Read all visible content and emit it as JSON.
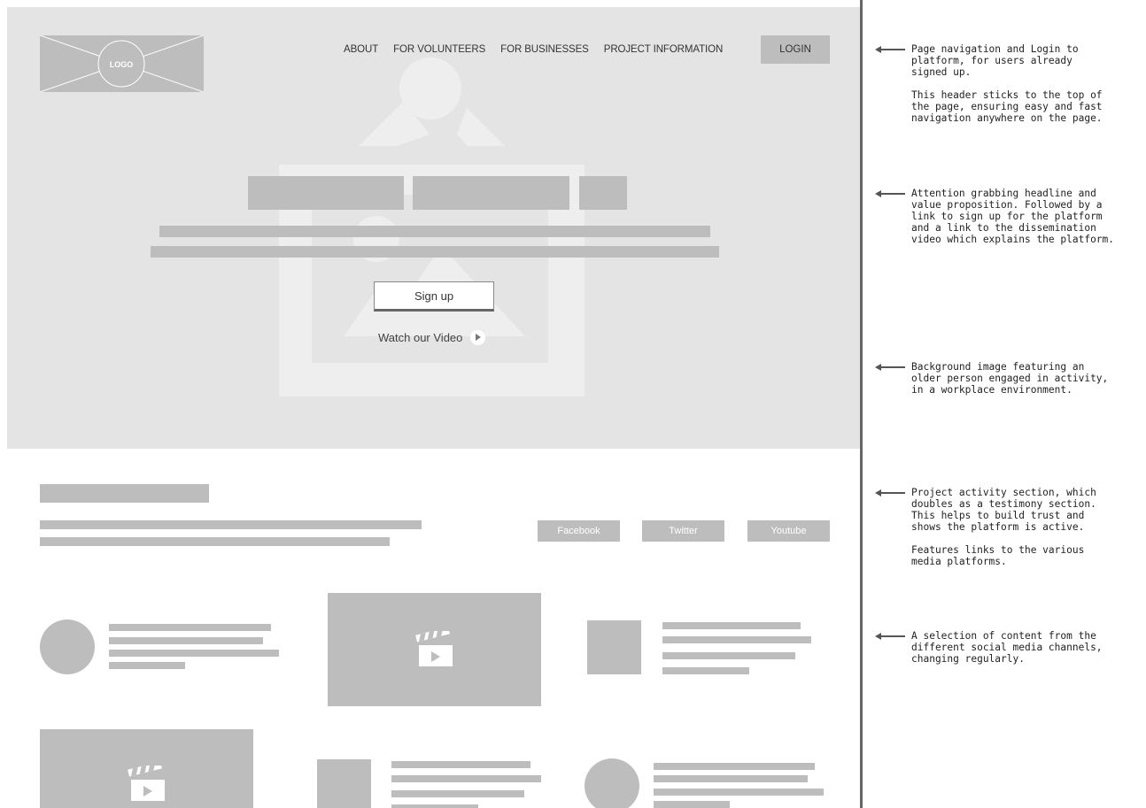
{
  "header": {
    "logo_text": "LOGO",
    "nav": [
      "ABOUT",
      "FOR VOLUNTEERS",
      "FOR BUSINESSES",
      "PROJECT INFORMATION"
    ],
    "login_label": "LOGIN"
  },
  "hero": {
    "signup_label": "Sign up",
    "video_label": "Watch our Video"
  },
  "activity": {
    "social_buttons": [
      "Facebook",
      "Twitter",
      "Youtube"
    ]
  },
  "annotations": [
    "Page navigation and Login to\nplatform, for users already\nsigned up.\n\nThis header sticks to the top of\nthe page, ensuring easy and fast\nnavigation anywhere on the page.",
    "Attention grabbing headline and\nvalue proposition. Followed by a\nlink to sign up for the platform\nand a link to the dissemination\nvideo which explains the platform.",
    "Background image featuring an\nolder person engaged in activity,\nin a workplace environment.",
    "Project activity section, which\ndoubles as a testimony section.\nThis helps to build trust and\nshows the platform is active.\n\nFeatures links to the various\nmedia platforms.",
    "A selection of content from the\ndifferent social media channels,\nchanging regularly."
  ]
}
